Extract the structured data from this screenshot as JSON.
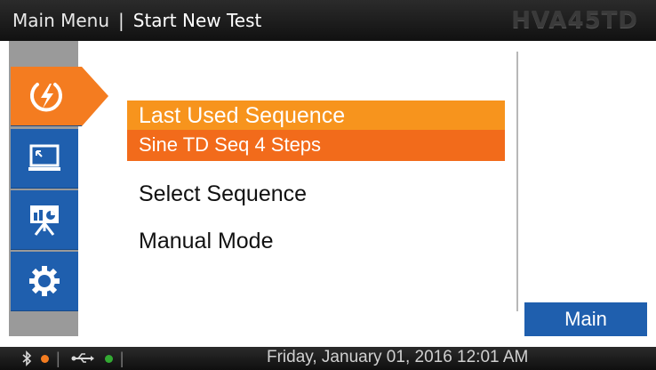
{
  "header": {
    "breadcrumb_root": "Main Menu",
    "breadcrumb_separator": "|",
    "breadcrumb_current": "Start New Test",
    "model_name": "HVA45TD"
  },
  "sidebar": {
    "tabs": [
      {
        "id": "test",
        "icon": "lightning-icon",
        "active": true
      },
      {
        "id": "screen",
        "icon": "monitor-icon",
        "active": false
      },
      {
        "id": "reports",
        "icon": "presentation-chart-icon",
        "active": false
      },
      {
        "id": "settings",
        "icon": "gear-icon",
        "active": false
      }
    ]
  },
  "menu": {
    "last_used_title": "Last Used Sequence",
    "last_used_value": "Sine TD Seq 4 Steps",
    "select_sequence": "Select Sequence",
    "manual_mode": "Manual Mode"
  },
  "buttons": {
    "main_label": "Main"
  },
  "status": {
    "bluetooth_icon": "bluetooth-icon",
    "usb_icon": "usb-icon",
    "bluetooth_led_color": "#f47c20",
    "usb_led_color": "#33aa33",
    "datetime": "Friday, January 01, 2016 12:01 AM"
  },
  "colors": {
    "accent_orange": "#f7941d",
    "accent_orange_dark": "#f26b1b",
    "brand_blue": "#1f5fae"
  }
}
